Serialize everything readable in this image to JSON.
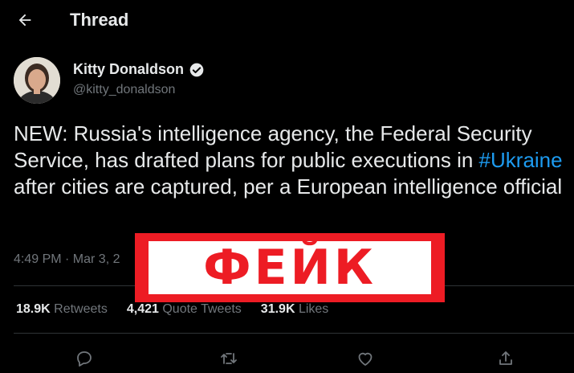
{
  "header": {
    "title": "Thread",
    "back_icon": "arrow-left-icon"
  },
  "author": {
    "name": "Kitty Donaldson",
    "handle": "@kitty_donaldson",
    "verified": true
  },
  "tweet": {
    "text_before": "NEW: Russia's intelligence agency, the Federal Security Service, has drafted plans for public executions in ",
    "hashtag": "#Ukraine",
    "text_after": " after cities are captured, per a European intelligence official",
    "timestamp": "4:49 PM · Mar 3, 2"
  },
  "stats": {
    "retweets_count": "18.9K",
    "retweets_label": "Retweets",
    "quotes_count": "4,421",
    "quotes_label": "Quote Tweets",
    "likes_count": "31.9K",
    "likes_label": "Likes"
  },
  "stamp": {
    "text": "ФЕЙК"
  },
  "colors": {
    "background": "#000000",
    "text": "#e7e9ea",
    "secondary": "#71767b",
    "link": "#1d9bf0",
    "stamp_red": "#ed1c24"
  }
}
